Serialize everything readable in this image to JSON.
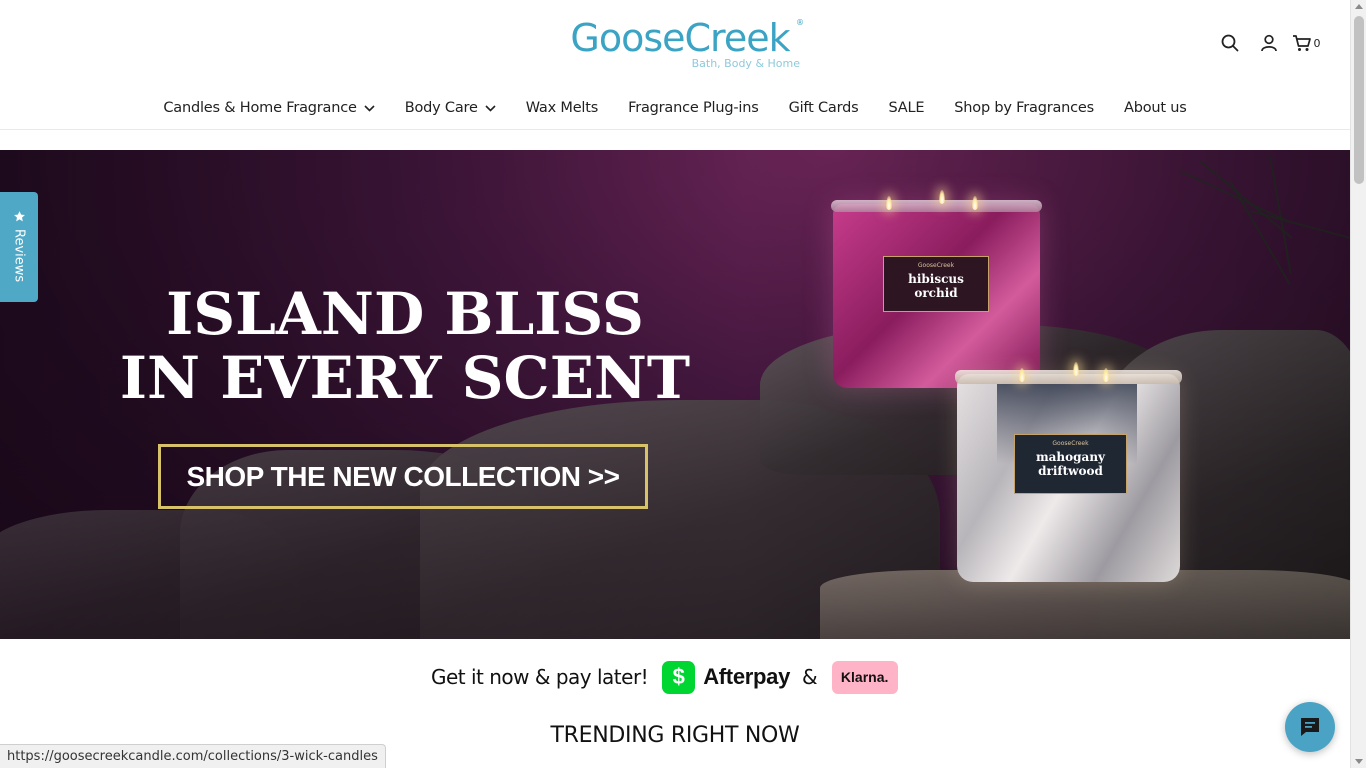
{
  "header": {
    "logo_text": "GooseCreek",
    "logo_registered": "®",
    "logo_tagline": "Bath, Body & Home",
    "icons": [
      "search-icon",
      "account-icon",
      "cart-icon"
    ],
    "cart_count": "0"
  },
  "nav": {
    "items": [
      {
        "label": "Candles & Home Fragrance",
        "has_dropdown": true
      },
      {
        "label": "Body Care",
        "has_dropdown": true
      },
      {
        "label": "Wax Melts",
        "has_dropdown": false
      },
      {
        "label": "Fragrance Plug-ins",
        "has_dropdown": false
      },
      {
        "label": "Gift Cards",
        "has_dropdown": false
      },
      {
        "label": "SALE",
        "has_dropdown": false
      },
      {
        "label": "Shop by Fragrances",
        "has_dropdown": false
      },
      {
        "label": "About us",
        "has_dropdown": false
      }
    ]
  },
  "hero": {
    "title_line1": "ISLAND BLISS",
    "title_line2": "IN EVERY SCENT",
    "cta_label": "SHOP THE NEW COLLECTION >>",
    "candles": [
      {
        "brand": "GooseCreek",
        "name_line1": "hibiscus",
        "name_line2": "orchid"
      },
      {
        "brand": "GooseCreek",
        "name_line1": "mahogany",
        "name_line2": "driftwood"
      }
    ],
    "colors": {
      "accent_border": "#d7c26a",
      "background": "#4b1a45"
    }
  },
  "reviews_tab": {
    "label": "Reviews",
    "icon": "star-icon"
  },
  "paylater": {
    "lead": "Get it now & pay later!",
    "cashapp_symbol": "$",
    "afterpay": "Afterpay",
    "amp": "&",
    "klarna": "Klarna."
  },
  "trending": {
    "title": "TRENDING RIGHT NOW"
  },
  "status_bar": {
    "url": "https://goosecreekcandle.com/collections/3-wick-candles"
  },
  "chat": {
    "icon": "chat-icon"
  },
  "colors": {
    "brand": "#3ba4c4",
    "reviews_tab": "#4fa8c5",
    "chat": "#4aa3c5"
  }
}
